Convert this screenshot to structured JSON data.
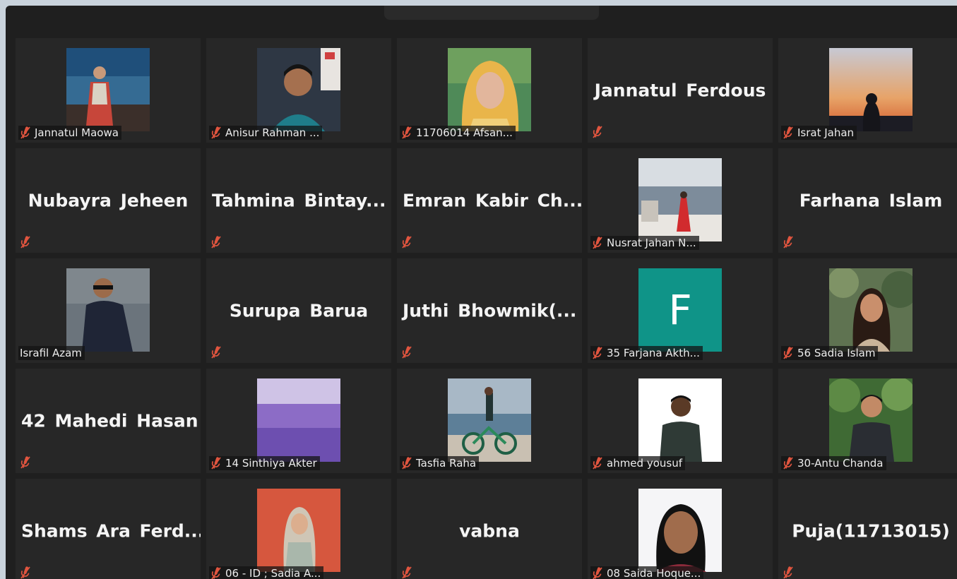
{
  "colors": {
    "background": "#1f1f1f",
    "tile": "#272727",
    "muted_icon": "#e0553f",
    "avatar_teal": "#0f9488"
  },
  "participants": [
    {
      "label": "Jannatul Maowa",
      "muted": true,
      "display": "photo",
      "photo": "lake-woman"
    },
    {
      "label": "Anisur Rahman ...",
      "muted": true,
      "display": "photo",
      "photo": "man-dark"
    },
    {
      "label": "11706014 Afsan...",
      "muted": true,
      "display": "photo",
      "photo": "hijab-yellow"
    },
    {
      "name": "Jannatul Ferdous",
      "muted": true,
      "display": "name"
    },
    {
      "label": "Israt Jahan",
      "muted": true,
      "display": "photo",
      "photo": "sunset-silhouette"
    },
    {
      "name": "Nubayra Jeheen",
      "muted": true,
      "display": "name"
    },
    {
      "name": "Tahmina Bintay...",
      "muted": true,
      "display": "name"
    },
    {
      "name": "Emran Kabir Ch...",
      "muted": true,
      "display": "name"
    },
    {
      "label": "Nusrat Jahan N...",
      "muted": true,
      "display": "photo",
      "photo": "sea-red-dress"
    },
    {
      "name": "Farhana Islam",
      "muted": true,
      "display": "name"
    },
    {
      "label": "Israfil Azam",
      "muted": false,
      "display": "photo",
      "photo": "man-water"
    },
    {
      "name": "Surupa Barua",
      "muted": true,
      "display": "name"
    },
    {
      "name": "Juthi Bhowmik(...",
      "muted": true,
      "display": "name"
    },
    {
      "label": "35 Farjana Akth...",
      "muted": true,
      "display": "letter",
      "letter": "F"
    },
    {
      "label": "56 Sadia Islam",
      "muted": true,
      "display": "photo",
      "photo": "woman-trees"
    },
    {
      "name": "42 Mahedi Hasan",
      "muted": true,
      "display": "name"
    },
    {
      "label": "14 Sinthiya Akter",
      "muted": true,
      "display": "photo",
      "photo": "lavender"
    },
    {
      "label": "Tasfia Raha",
      "muted": true,
      "display": "photo",
      "photo": "beach-bicycle"
    },
    {
      "label": "ahmed yousuf",
      "muted": true,
      "display": "photo",
      "photo": "man-white"
    },
    {
      "label": "30-Antu Chanda",
      "muted": true,
      "display": "photo",
      "photo": "man-green"
    },
    {
      "name": "Shams Ara Ferd...",
      "muted": true,
      "display": "name"
    },
    {
      "label": "06 - ID ; Sadia A...",
      "muted": true,
      "display": "photo",
      "photo": "hijab-red-wall"
    },
    {
      "name": "vabna",
      "muted": true,
      "display": "name"
    },
    {
      "label": "08 Saida Hoque...",
      "muted": true,
      "display": "photo",
      "photo": "passport-woman"
    },
    {
      "name": "Puja(11713015)",
      "muted": true,
      "display": "name"
    }
  ]
}
